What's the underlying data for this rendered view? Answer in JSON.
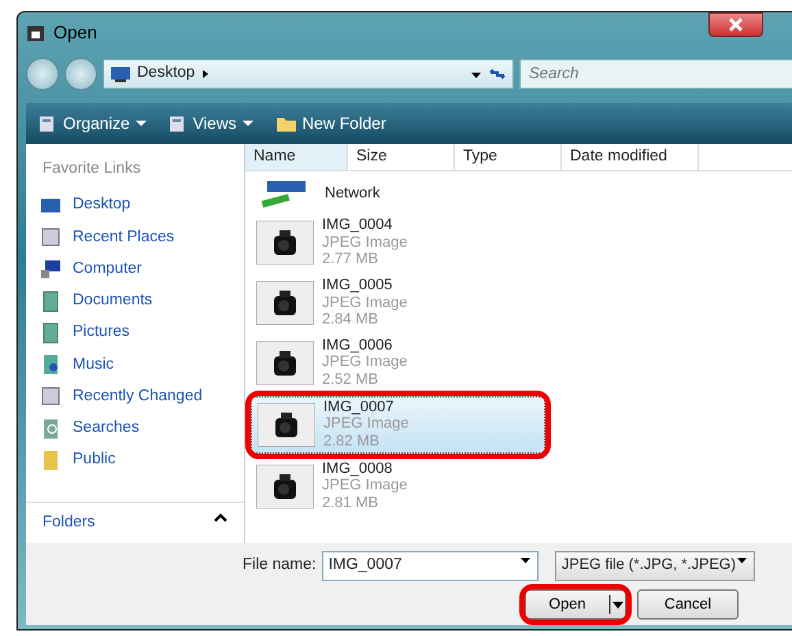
{
  "window": {
    "title": "Open"
  },
  "address": {
    "location": "Desktop",
    "search_placeholder": "Search"
  },
  "toolbar": [
    {
      "label": "Organize",
      "kind": "menu"
    },
    {
      "label": "Views",
      "kind": "menu"
    },
    {
      "label": "New Folder",
      "kind": "folder"
    }
  ],
  "sidebar": {
    "heading": "Favorite Links",
    "items": [
      {
        "label": "Desktop",
        "kind": "desktop"
      },
      {
        "label": "Recent Places",
        "kind": "recent"
      },
      {
        "label": "Computer",
        "kind": "computer"
      },
      {
        "label": "Documents",
        "kind": "docs"
      },
      {
        "label": "Pictures",
        "kind": "docs"
      },
      {
        "label": "Music",
        "kind": "music"
      },
      {
        "label": "Recently Changed",
        "kind": "recent"
      },
      {
        "label": "Searches",
        "kind": "search"
      },
      {
        "label": "Public",
        "kind": "folder"
      }
    ],
    "folders_label": "Folders"
  },
  "columns": [
    "Name",
    "Size",
    "Type",
    "Date modified"
  ],
  "files": [
    {
      "name": "Network",
      "kind": "network",
      "selected": false,
      "circled": false
    },
    {
      "name": "IMG_0004",
      "type": "JPEG Image",
      "size": "2.77 MB",
      "selected": false,
      "circled": false
    },
    {
      "name": "IMG_0005",
      "type": "JPEG Image",
      "size": "2.84 MB",
      "selected": false,
      "circled": false
    },
    {
      "name": "IMG_0006",
      "type": "JPEG Image",
      "size": "2.52 MB",
      "selected": false,
      "circled": false
    },
    {
      "name": "IMG_0007",
      "type": "JPEG Image",
      "size": "2.82 MB",
      "selected": true,
      "circled": true
    },
    {
      "name": "IMG_0008",
      "type": "JPEG Image",
      "size": "2.81 MB",
      "selected": false,
      "circled": false
    }
  ],
  "footer": {
    "file_name_label": "File name:",
    "file_name": "IMG_0007",
    "filter": "JPEG file (*.JPG, *.JPEG)",
    "buttons": [
      {
        "label": "Open",
        "kind": "split",
        "circled": true
      },
      {
        "label": "Cancel",
        "kind": "plain",
        "circled": false
      }
    ]
  }
}
